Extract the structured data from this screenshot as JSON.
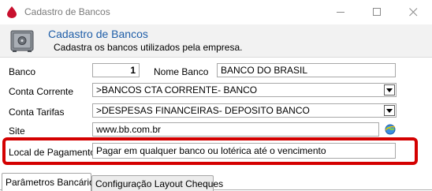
{
  "window": {
    "title": "Cadastro de Bancos",
    "controls": [
      "minimize",
      "maximize",
      "close"
    ]
  },
  "header": {
    "title": "Cadastro de Bancos",
    "subtitle": "Cadastra os bancos utilizados pela empresa.",
    "icon": "safe-icon"
  },
  "form": {
    "banco": {
      "label": "Banco",
      "value": "1"
    },
    "nome_banco": {
      "label": "Nome Banco",
      "value": "BANCO DO BRASIL"
    },
    "conta_corrente": {
      "label": "Conta Corrente",
      "value": ">BANCOS CTA CORRENTE- BANCO"
    },
    "conta_tarifas": {
      "label": "Conta Tarifas",
      "value": ">DESPESAS FINANCEIRAS- DEPOSITO BANCO"
    },
    "site": {
      "label": "Site",
      "value": "www.bb.com.br",
      "icon": "globe-icon"
    },
    "local_pagamento": {
      "label": "Local de Pagamento",
      "value": "Pagar em qualquer banco ou lotérica até o vencimento"
    }
  },
  "tabs": [
    {
      "label": "Parâmetros Bancários",
      "active": true
    },
    {
      "label": "Configuração Layout Cheques",
      "active": false
    }
  ],
  "colors": {
    "header_title": "#1f5ea8",
    "highlight_border": "#d40000",
    "header_bg": "#f2f2f2"
  }
}
